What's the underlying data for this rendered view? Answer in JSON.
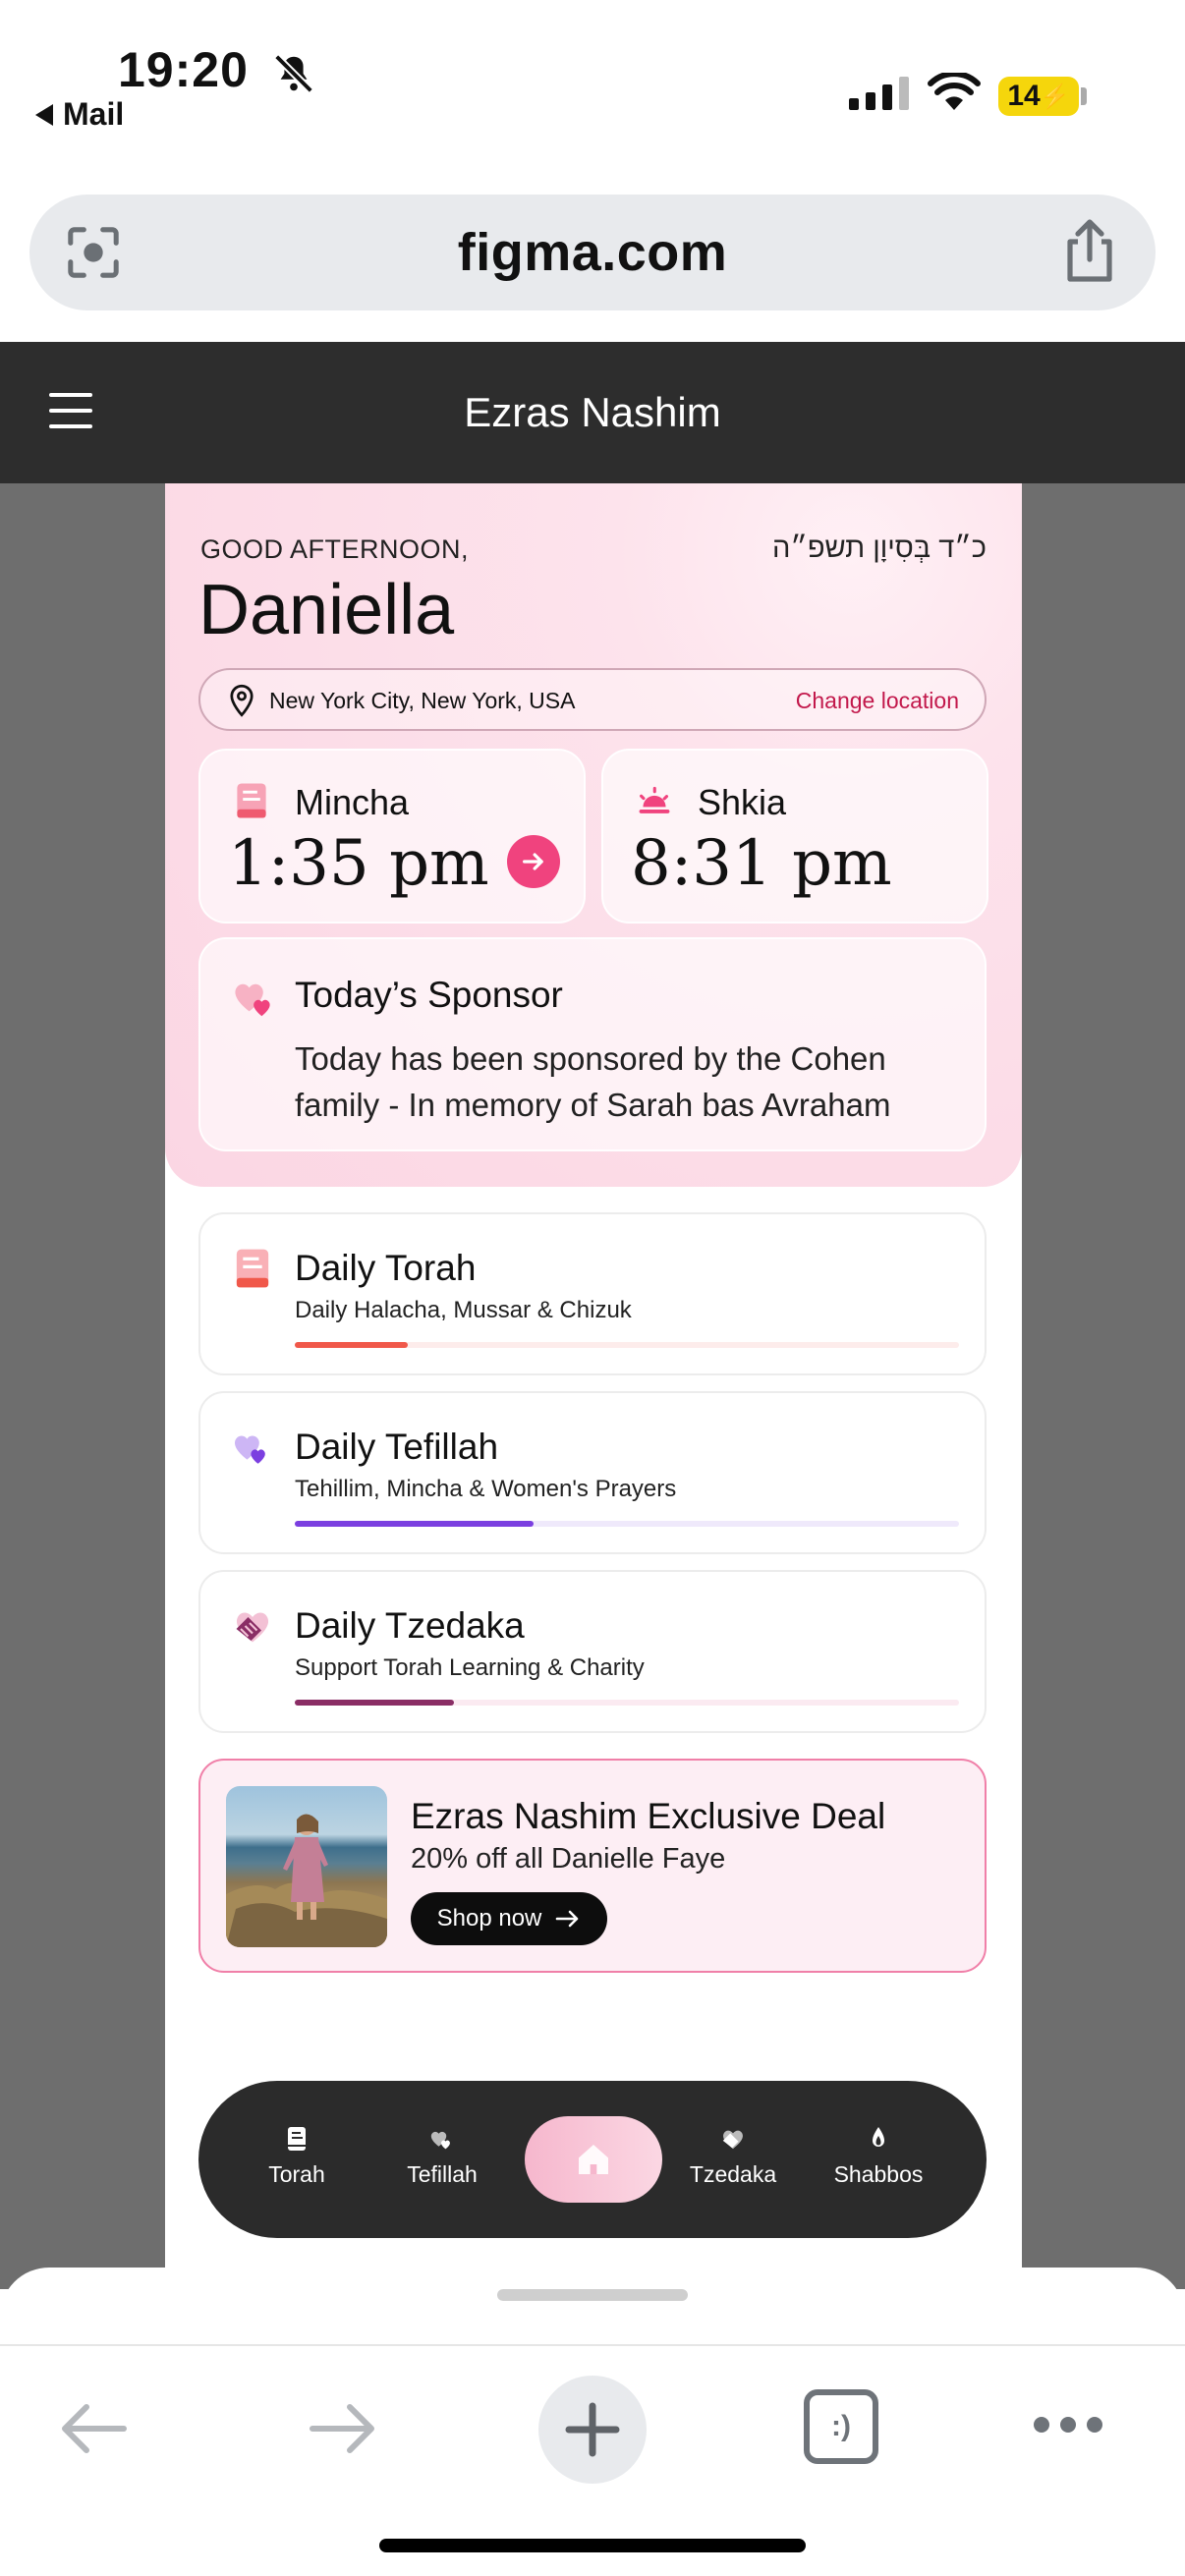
{
  "status_bar": {
    "time": "19:20",
    "back_app": "Mail",
    "battery": "14"
  },
  "browser": {
    "url": "figma.com",
    "tabs_label": ":)"
  },
  "app": {
    "title": "Ezras Nashim",
    "greeting": "GOOD AFTERNOON,",
    "hebrew_date": "כ״ד בְּסִיוָן תשפ״ה",
    "user_name": "Daniella",
    "location": {
      "city": "New York City, New York, USA",
      "change_label": "Change location"
    },
    "times": [
      {
        "label": "Mincha",
        "time": "1:35 pm"
      },
      {
        "label": "Shkia",
        "time": "8:31 pm"
      }
    ],
    "sponsor": {
      "title": "Today’s Sponsor",
      "text": "Today has been sponsored by the Cohen family - In memory of Sarah bas Avraham"
    },
    "daily": [
      {
        "title": "Daily Torah",
        "subtitle": "Daily Halacha, Mussar & Chizuk",
        "progress": 0.17,
        "color": "#f0584a",
        "track": "#fdeceb"
      },
      {
        "title": "Daily Tefillah",
        "subtitle": "Tehillim, Mincha & Women's Prayers",
        "progress": 0.36,
        "color": "#7b3fe0",
        "track": "#efe9fb"
      },
      {
        "title": "Daily Tzedaka",
        "subtitle": "Support Torah Learning & Charity",
        "progress": 0.24,
        "color": "#8a2d65",
        "track": "#fbeaf1"
      }
    ],
    "deal": {
      "title": "Ezras Nashim Exclusive Deal",
      "subtitle": "20% off all Danielle Faye",
      "button": "Shop now"
    },
    "tabbar": [
      {
        "label": "Torah",
        "icon": "book-icon"
      },
      {
        "label": "Tefillah",
        "icon": "heart-icon"
      },
      {
        "label": "",
        "icon": "home-icon"
      },
      {
        "label": "Tzedaka",
        "icon": "hand-heart-icon"
      },
      {
        "label": "Shabbos",
        "icon": "candle-icon"
      }
    ]
  },
  "colors": {
    "accent_pink": "#f0437e",
    "header_dark": "#2d2d2d",
    "link_red": "#c2184b"
  }
}
